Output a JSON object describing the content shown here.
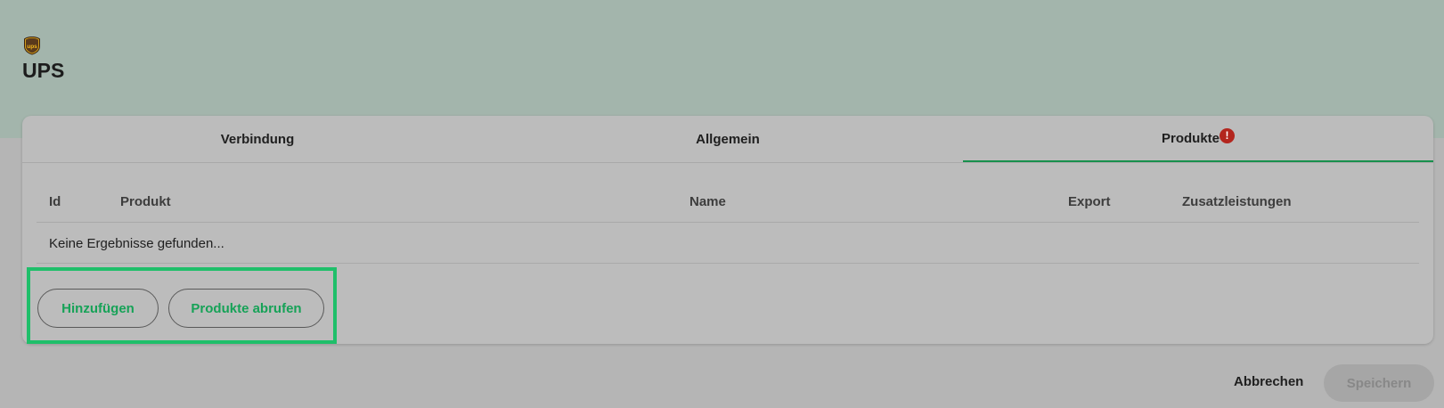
{
  "header": {
    "title": "UPS",
    "logo_icon": "ups-logo-icon",
    "logo_text": "ups"
  },
  "tabs": [
    {
      "label": "Verbindung"
    },
    {
      "label": "Allgemein"
    },
    {
      "label": "Produkte",
      "badge": "!",
      "active": true
    }
  ],
  "table": {
    "columns": [
      "Id",
      "Produkt",
      "Name",
      "Export",
      "Zusatzleistungen"
    ],
    "empty_message": "Keine Ergebnisse gefunden..."
  },
  "actions": {
    "add_label": "Hinzufügen",
    "fetch_label": "Produkte abrufen"
  },
  "footer": {
    "cancel_label": "Abbrechen",
    "save_label": "Speichern"
  },
  "colors": {
    "accent": "#17904d",
    "highlight": "#1fbf6a",
    "alert": "#b3261e"
  }
}
